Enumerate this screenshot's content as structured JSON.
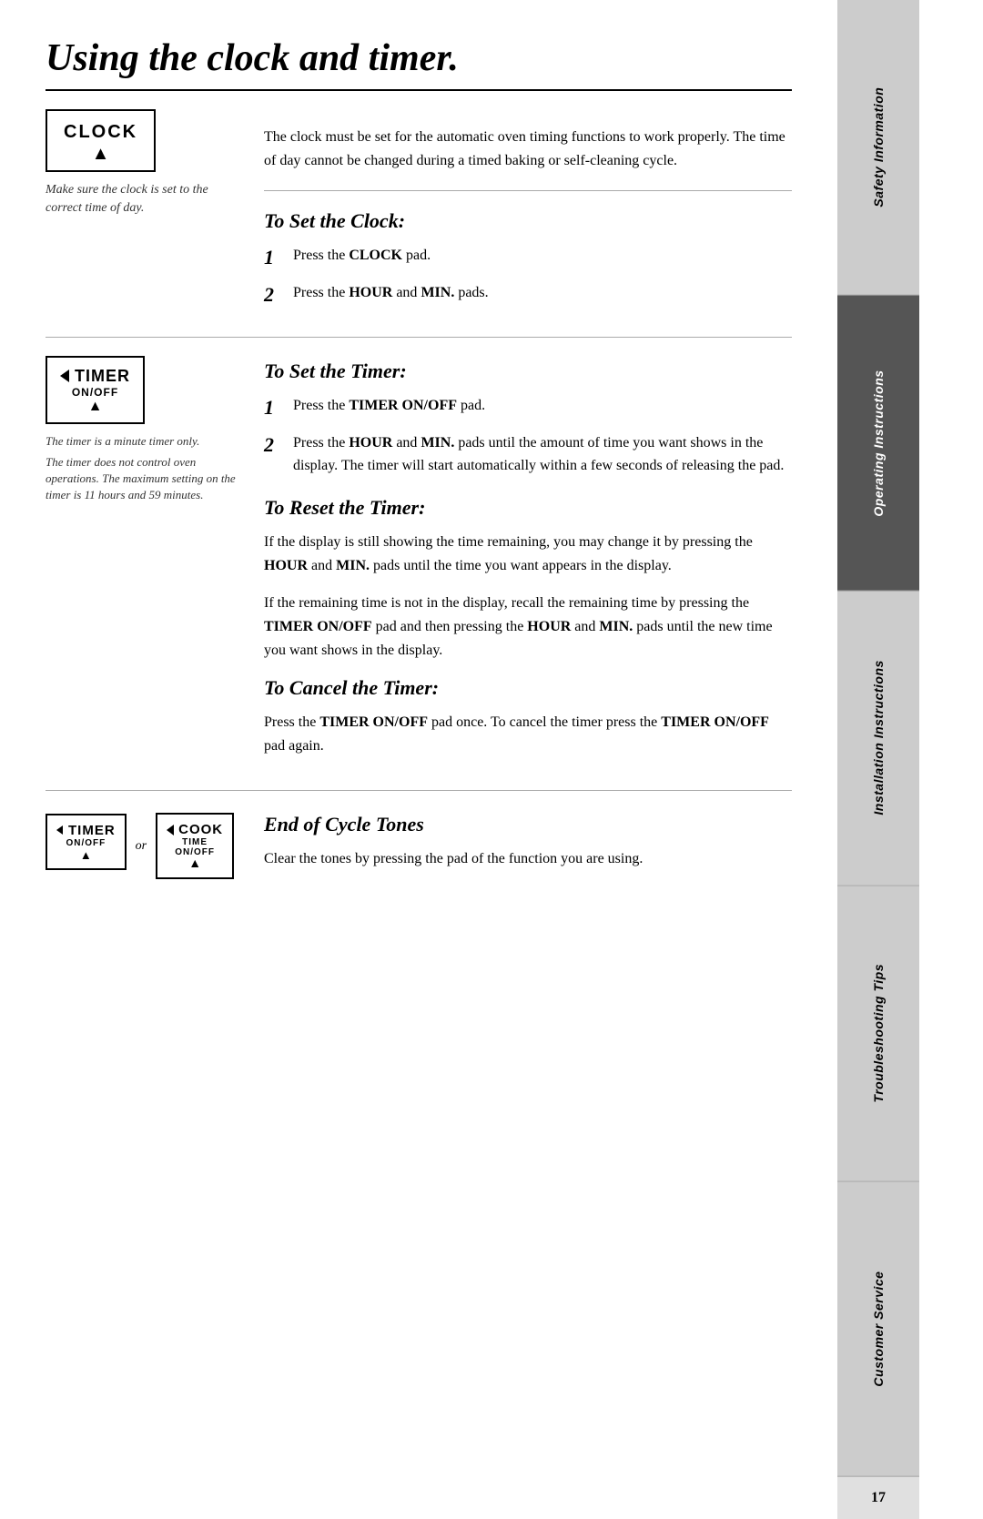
{
  "page": {
    "title": "Using the clock and timer.",
    "page_number": "17"
  },
  "clock_section": {
    "box_label": "CLOCK",
    "caption": "Make sure the clock is set to the correct time of day.",
    "intro": "The clock must be set for the automatic oven timing functions to work properly. The time of day cannot be changed during a timed baking or self-cleaning cycle.",
    "set_clock_heading": "To Set the Clock:",
    "step1": "Press the ",
    "step1_bold": "CLOCK",
    "step1_end": " pad.",
    "step2": "Press the ",
    "step2_bold1": "HOUR",
    "step2_mid": " and ",
    "step2_bold2": "MIN.",
    "step2_end": " pads."
  },
  "timer_section": {
    "box_label": "TIMER",
    "box_sublabel": "ON/OFF",
    "caption1": "The timer is a minute timer only.",
    "caption2": "The timer does not control oven operations. The maximum setting on the timer is 11 hours and 59 minutes.",
    "set_timer_heading": "To Set the Timer:",
    "step1": "Press the ",
    "step1_bold": "TIMER ON/OFF",
    "step1_end": " pad.",
    "step2_start": "Press the ",
    "step2_bold1": "HOUR",
    "step2_mid1": " and ",
    "step2_bold2": "MIN.",
    "step2_rest": " pads until the amount of time you want shows in the display. The timer will start automatically within a few seconds of releasing the pad.",
    "reset_timer_heading": "To Reset the Timer:",
    "reset_para1": "If the display is still showing the time remaining, you may change it by pressing the ",
    "reset_bold1": "HOUR",
    "reset_mid1": " and ",
    "reset_bold2": "MIN.",
    "reset_rest1": " pads until the time you want appears in the display.",
    "reset_para2": "If the remaining time is not in the display, recall the remaining time by pressing the ",
    "reset2_bold1": "TIMER ON/OFF",
    "reset2_mid1": " pad and then pressing the ",
    "reset2_bold2": "HOUR",
    "reset2_mid2": " and ",
    "reset2_bold3": "MIN.",
    "reset2_rest": " pads until the new time you want shows in the display.",
    "cancel_timer_heading": "To Cancel the Timer:",
    "cancel_para": "Press the ",
    "cancel_bold1": "TIMER ON/OFF",
    "cancel_mid": " pad once. To cancel the timer press the ",
    "cancel_bold2": "TIMER ON/OFF",
    "cancel_end": " pad again."
  },
  "end_cycle": {
    "heading": "End of Cycle Tones",
    "timer_label": "TIMER",
    "timer_sublabel": "ON/OFF",
    "or_text": "or",
    "cook_time_label": "COOK",
    "cook_time_sub1": "TIME",
    "cook_time_sub2": "ON/OFF",
    "para": "Clear the tones by pressing the pad of the function you are using."
  },
  "sidebar": {
    "tabs": [
      {
        "label": "Safety Information",
        "active": false
      },
      {
        "label": "Operating Instructions",
        "active": true
      },
      {
        "label": "Installation Instructions",
        "active": false
      },
      {
        "label": "Troubleshooting Tips",
        "active": false
      },
      {
        "label": "Customer Service",
        "active": false
      }
    ]
  }
}
